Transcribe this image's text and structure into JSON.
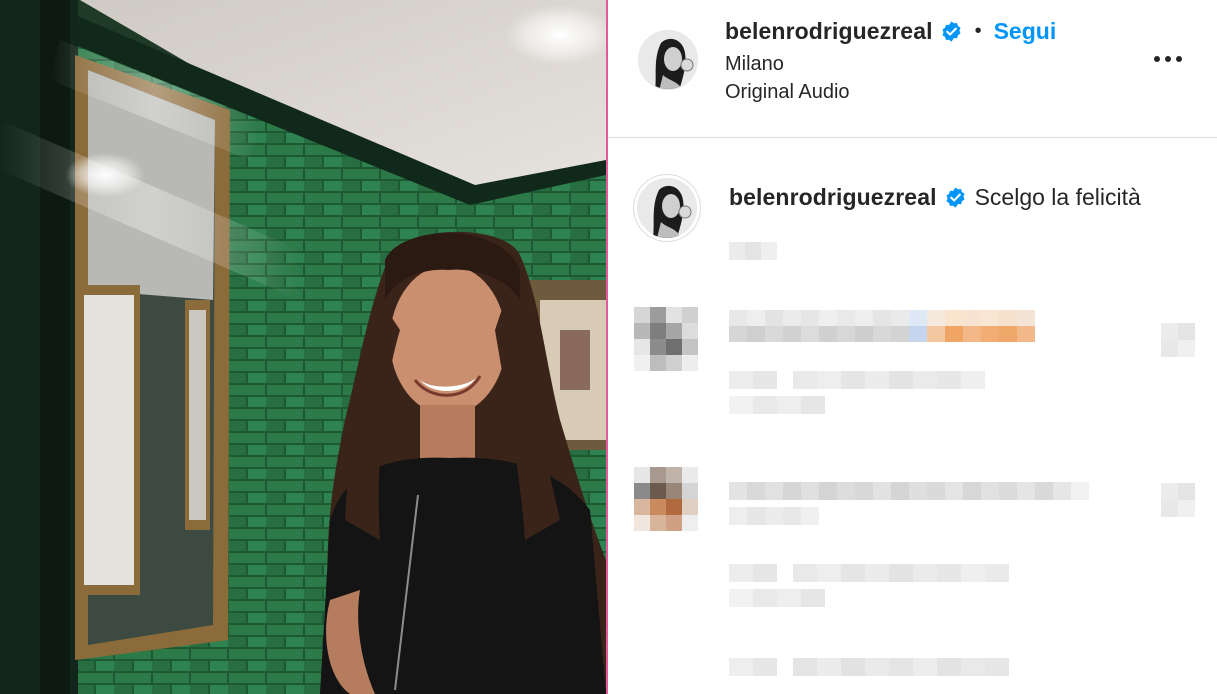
{
  "post": {
    "username": "belenrodriguezreal",
    "follow_label": "Segui",
    "separator": "•",
    "location": "Milano",
    "audio": "Original Audio",
    "caption": "Scelgo la felicità"
  },
  "icons": {
    "verified": "verified-badge-icon",
    "more": "more-options-icon",
    "like": "heart-icon"
  },
  "colors": {
    "follow": "#0095f6",
    "verified": "#0095f6",
    "text": "#262626",
    "divider": "#dbdbdb"
  }
}
